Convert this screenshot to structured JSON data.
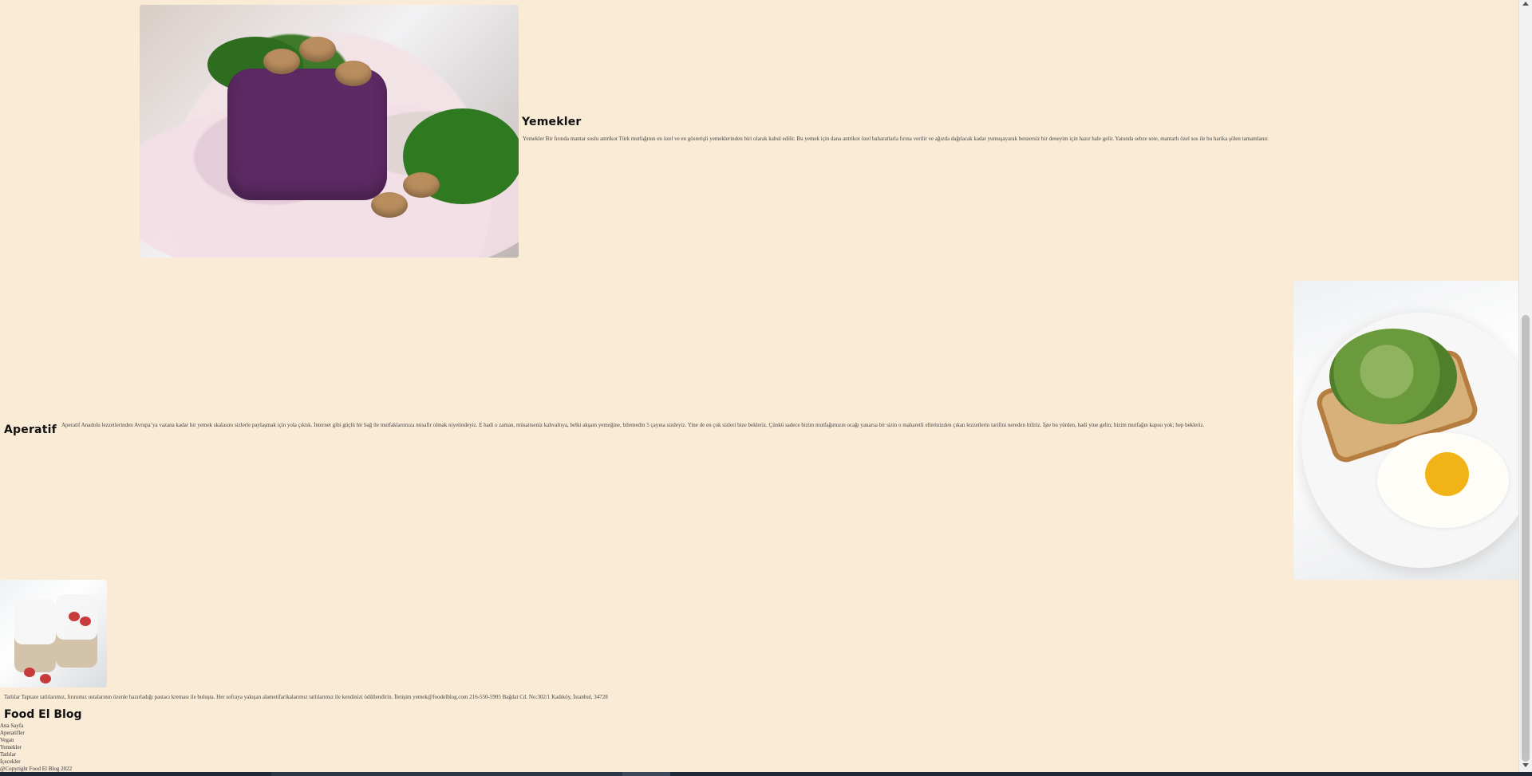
{
  "sections": [
    {
      "title": "Yemekler",
      "description": "Yemekler Bir fırında mantar soslu antrikot Türk mutfağının en özel ve en gösterişli yemeklerinden biri olarak kabul edilir. Bu yemek için dana antrikot özel baharatlarla fırına verilir ve ağızda dağılacak kadar yumuşayarak benzersiz bir deneyim için hazır hale gelir. Yanında sebze sote, mantarlı özel sos ile bu harika şölen tamamlanır."
    },
    {
      "title": "Aperatif",
      "description": "Aperatif Anadolu lezzetlerinden Avrupa’ya vazana kadar bir yemek skalasını sizlerle paylaşmak için yola çıktık. İnternet gibi güçlü bir bağ ile mutfaklarımıza misafir olmak niyetindeyiz. E hadi o zaman, müsaitseniz kahvaltıya, belki akşam yemeğine, bilemedin 5 çayına sizdeyiz. Yine de en çok sizleri bize bekleriz. Çünkü sadece bizim mutfağımızın ocağı yanarsa bir sizin o maharetli ellerinizden çıkan lezzetlerin tarifini nereden biliriz. İşte bu yürden, hadi yine gelin; bizim mutfağın kapısı yok; hep bekleriz."
    },
    {
      "title": "",
      "description": "Tatlılar Taptaze tatlılarımız, fırınımız ustalarının özenle hazırladığı pastacı kreması ile buluşta. Her sofraya yakışan alametifarikalarımız tatlılarımız ile kendinizi ödüllendirin. İletişim yemek@foodelblog.com 216-550-5905 Bağdat Cd. No:302/1 Kadıköy, İstanbul, 34728"
    }
  ],
  "footer": {
    "brand": "Food El Blog",
    "links": [
      "Ana Sayfa",
      "Aperatifler",
      "Vegan",
      "Yemekler",
      "Tatlılar",
      "İçecekler"
    ],
    "copyright": "@Copyright Food El Blog 2022"
  },
  "icons": {
    "scroll_up": "chevron-up-icon",
    "scroll_down": "chevron-down-icon"
  },
  "colors": {
    "background": "#faebd7",
    "text": "#333333",
    "title": "#111111"
  }
}
